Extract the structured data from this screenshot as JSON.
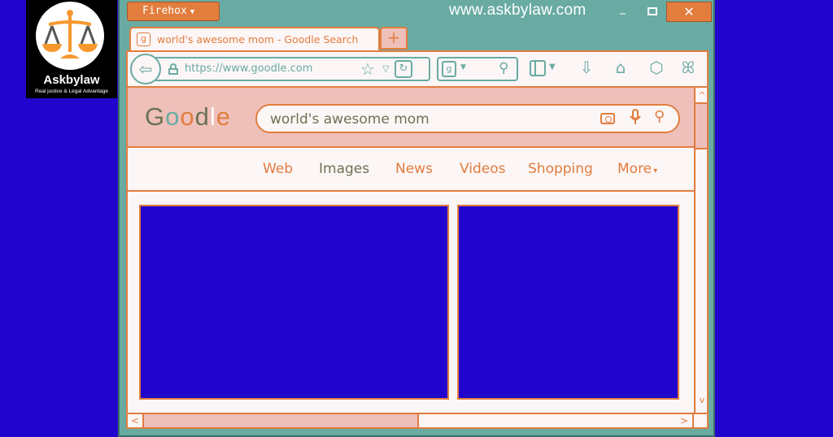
{
  "logo": {
    "brand": "Askbylaw",
    "tagline": "Real justice & Legal Advantage",
    "icon": "scales-of-justice-icon"
  },
  "window": {
    "app_menu_label": "Firehox",
    "app_menu_arrow": "▼",
    "site_title": "www.askbylaw.com",
    "minimize_glyph": "_",
    "close_glyph": "✕"
  },
  "tab": {
    "favicon": "g",
    "title": "world's awesome mom - Goodle Search",
    "new_tab_glyph": "+"
  },
  "toolbar": {
    "back_glyph": "⇦",
    "url": "https://www.goodle.com",
    "star_glyph": "☆",
    "dropdown_glyph": "▽",
    "reload_glyph": "↻",
    "search_engine_favicon": "g",
    "search_engine_drop": "▼",
    "search_glyph": "⚲",
    "sidebar_drop": "▼",
    "download_glyph": "⇩",
    "home_glyph": "⌂",
    "extensions_glyph": "⬡",
    "more_glyph": "ꕤ"
  },
  "page": {
    "logo_letters": [
      "G",
      "o",
      "o",
      "d",
      "l",
      "e"
    ],
    "query": "world's awesome mom",
    "camera_icon": "camera-icon",
    "mic_glyph": "🎙",
    "search_glyph": "⚲",
    "nav": [
      {
        "label": "Web",
        "color": "#e27d3e"
      },
      {
        "label": "Images",
        "color": "#6b7352"
      },
      {
        "label": "News",
        "color": "#e27d3e"
      },
      {
        "label": "Videos",
        "color": "#e27d3e"
      },
      {
        "label": "Shopping",
        "color": "#e27d3e"
      },
      {
        "label": "More",
        "color": "#e27d3e"
      }
    ],
    "more_arrow": "▾"
  },
  "scrollbars": {
    "up": "^",
    "down": "v",
    "left": "<",
    "right": ">"
  },
  "colors": {
    "background": "#2205cc",
    "window_teal": "#69aba3",
    "accent_orange": "#e27d3e",
    "header_pink": "#efc0ba",
    "paper": "#fcf6f6",
    "olive": "#6b7352"
  }
}
